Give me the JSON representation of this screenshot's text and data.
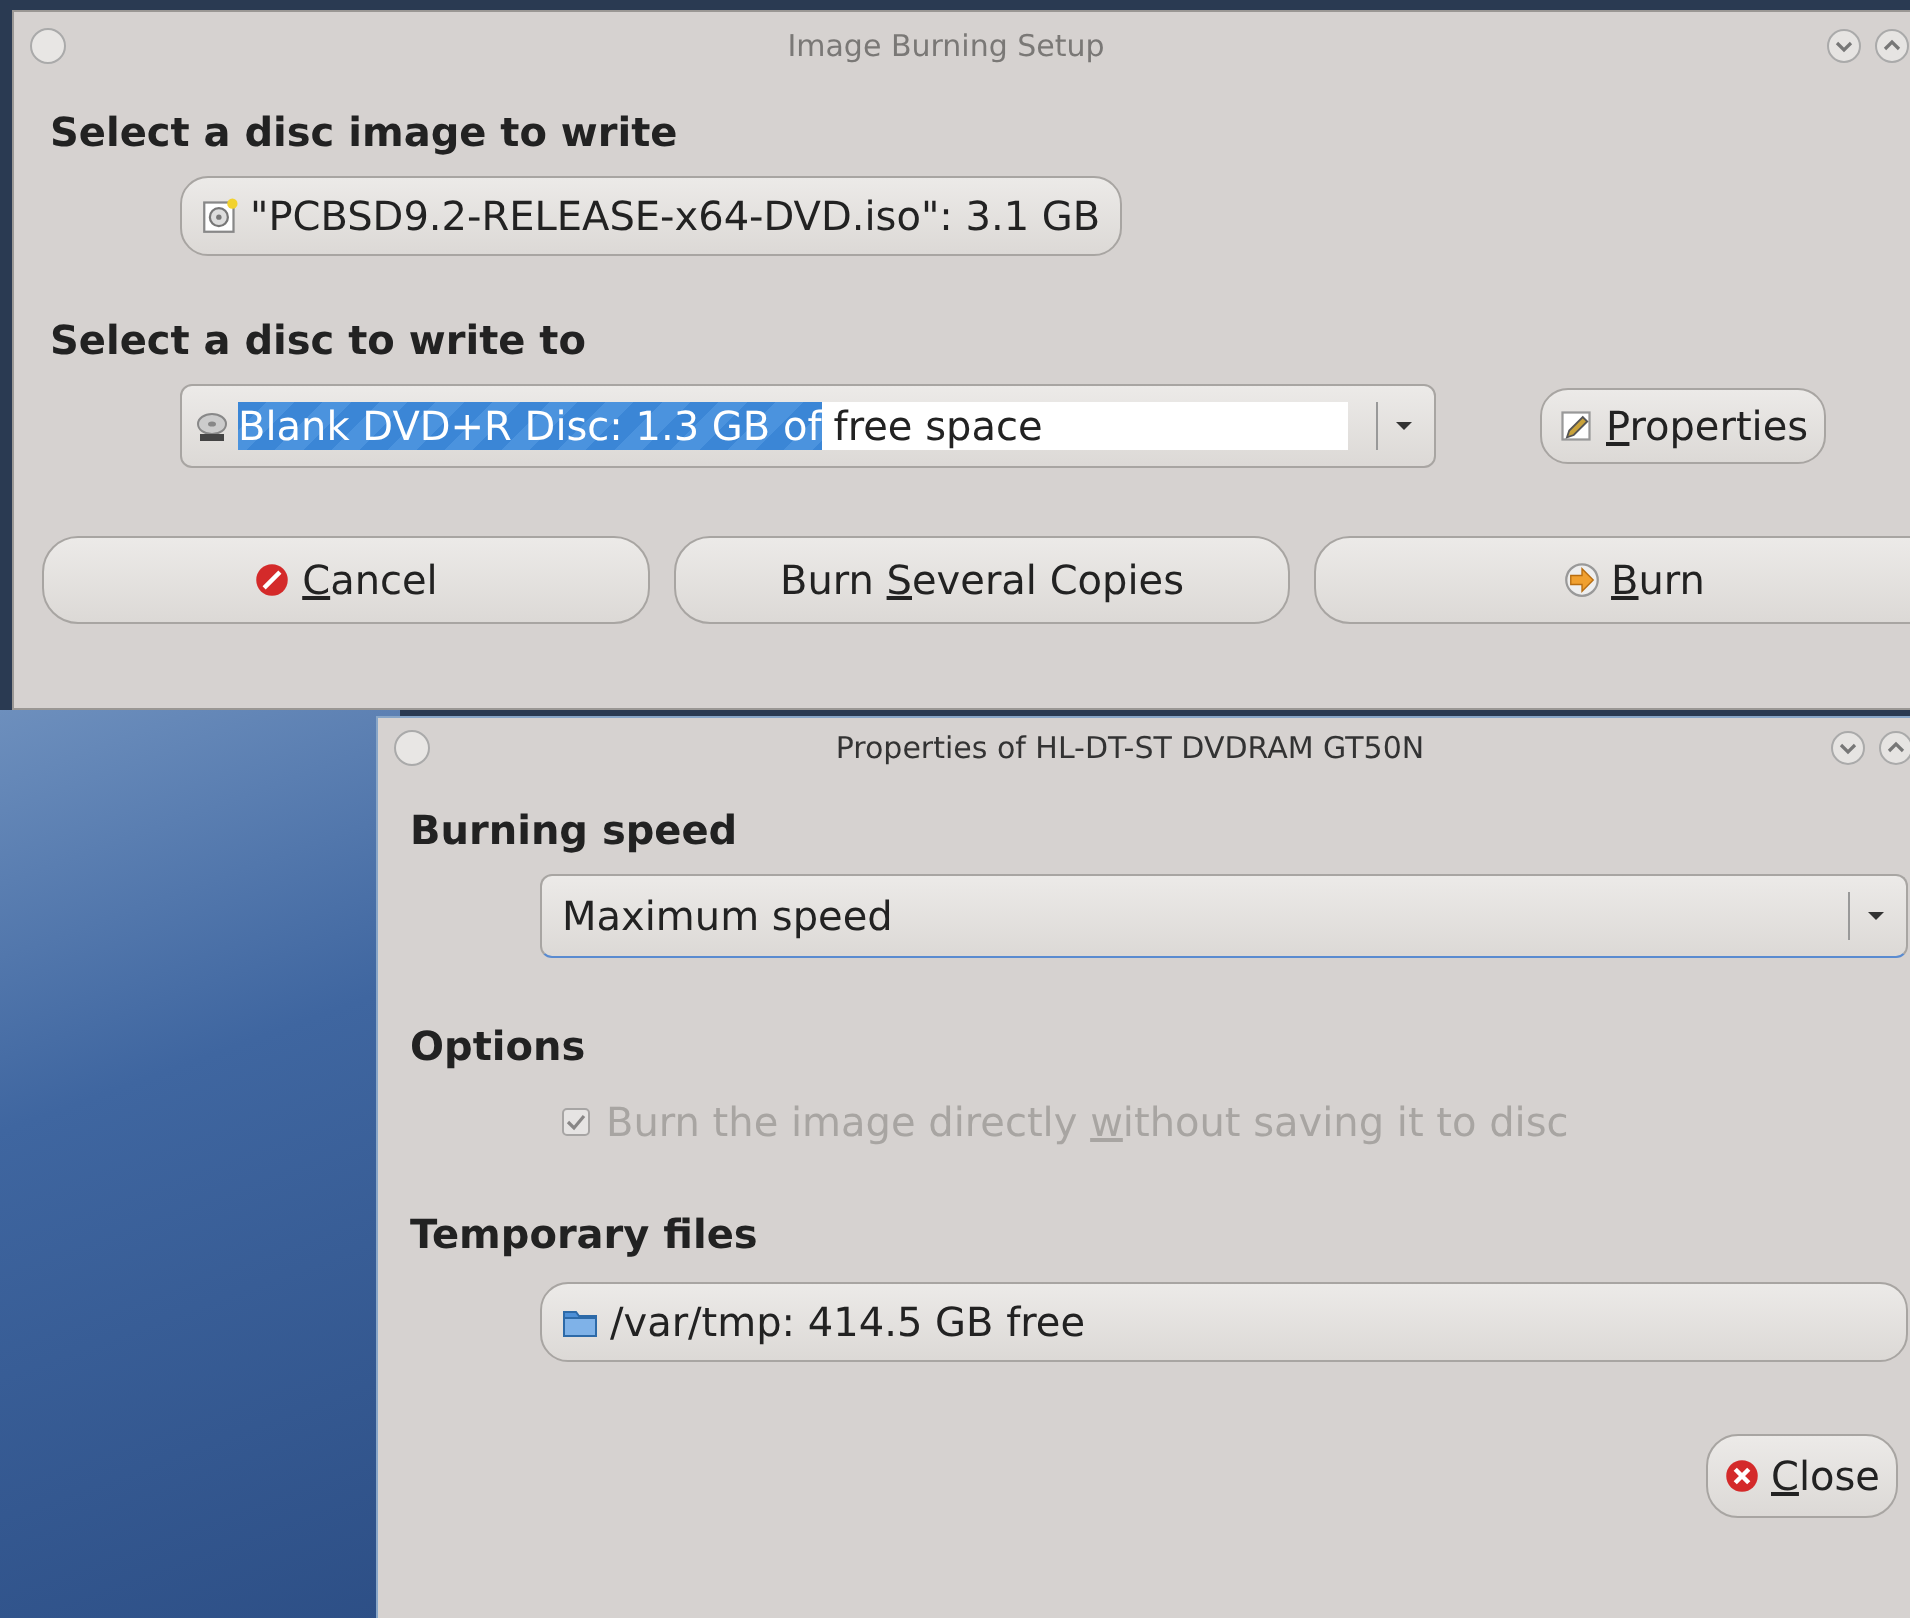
{
  "main_window": {
    "title": "Image Burning Setup",
    "image_section": {
      "heading": "Select a disc image to write",
      "image": "\"PCBSD9.2-RELEASE-x64-DVD.iso\": 3.1 GB"
    },
    "disc_section": {
      "heading": "Select a disc to write to",
      "disc_selected_text": "Blank DVD+R Disc: 1.3 GB of",
      "disc_rest_text": "free space",
      "properties_button": {
        "key": "P",
        "post": "roperties"
      }
    },
    "buttons": [
      {
        "kind": "cancel",
        "key": "C",
        "post": "ancel"
      },
      {
        "kind": "plain",
        "pre": "Burn ",
        "key": "S",
        "post": "everal Copies"
      },
      {
        "kind": "burn",
        "key": "B",
        "post": "urn"
      }
    ]
  },
  "properties_window": {
    "title": "Properties of HL-DT-ST DVDRAM GT50N",
    "speed_heading": "Burning speed",
    "speed": "Maximum speed",
    "options_heading": "Options",
    "options": [
      {
        "pre": "Burn the image directly ",
        "key": "w",
        "post": "ithout saving it to disc",
        "checked": true,
        "disabled": true
      }
    ],
    "temp_heading": "Temporary files",
    "temp_location": "/var/tmp: 414.5 GB free",
    "close_button": {
      "key": "C",
      "post": "lose"
    }
  }
}
